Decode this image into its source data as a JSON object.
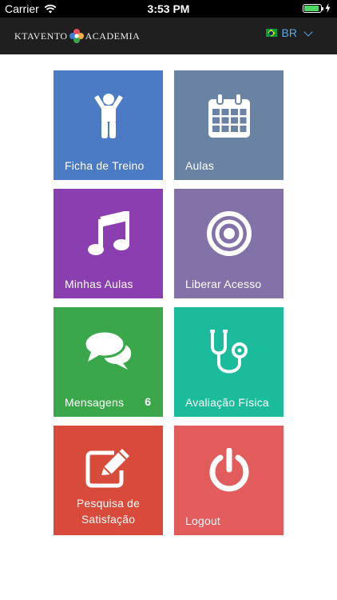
{
  "status": {
    "carrier": "Carrier",
    "time": "3:53 PM",
    "battery_percent": 90
  },
  "header": {
    "logo_left": "KTAVENTO",
    "logo_right": "ACADEMIA",
    "language": "BR"
  },
  "tiles": [
    {
      "label": "Ficha de Treino",
      "icon": "person-icon",
      "color": "#4a7bc4"
    },
    {
      "label": "Aulas",
      "icon": "calendar-icon",
      "color": "#6a82a4"
    },
    {
      "label": "Minhas Aulas",
      "icon": "music-note-icon",
      "color": "#8a3eb0"
    },
    {
      "label": "Liberar Acesso",
      "icon": "target-icon",
      "color": "#8372a8"
    },
    {
      "label": "Mensagens",
      "badge": "6",
      "icon": "chat-bubbles-icon",
      "color": "#3aa84a"
    },
    {
      "label": "Avaliação Física",
      "icon": "stethoscope-icon",
      "color": "#1abc9c"
    },
    {
      "label_line1": "Pesquisa de",
      "label_line2": "Satisfação",
      "icon": "edit-icon",
      "color": "#d84a3a"
    },
    {
      "label": "Logout",
      "icon": "power-icon",
      "color": "#e25c5c"
    }
  ]
}
